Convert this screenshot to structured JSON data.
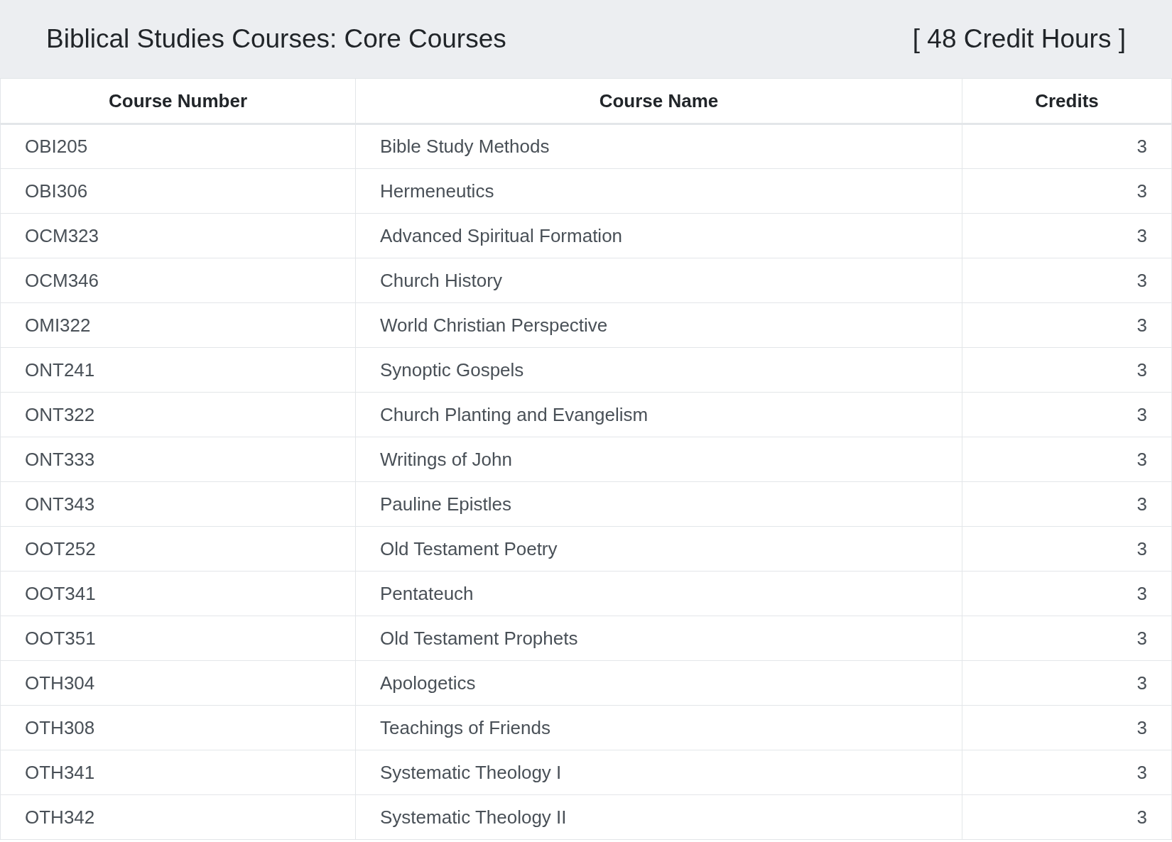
{
  "header": {
    "title": "Biblical Studies Courses: Core Courses",
    "credit_hours": "[ 48 Credit Hours ]"
  },
  "table": {
    "columns": [
      "Course Number",
      "Course Name",
      "Credits"
    ],
    "rows": [
      {
        "number": "OBI205",
        "name": "Bible Study Methods",
        "credits": "3"
      },
      {
        "number": "OBI306",
        "name": "Hermeneutics",
        "credits": "3"
      },
      {
        "number": "OCM323",
        "name": "Advanced Spiritual Formation",
        "credits": "3"
      },
      {
        "number": "OCM346",
        "name": "Church History",
        "credits": "3"
      },
      {
        "number": "OMI322",
        "name": "World Christian Perspective",
        "credits": "3"
      },
      {
        "number": "ONT241",
        "name": "Synoptic Gospels",
        "credits": "3"
      },
      {
        "number": "ONT322",
        "name": "Church Planting and Evangelism",
        "credits": "3"
      },
      {
        "number": "ONT333",
        "name": "Writings of John",
        "credits": "3"
      },
      {
        "number": "ONT343",
        "name": "Pauline Epistles",
        "credits": "3"
      },
      {
        "number": "OOT252",
        "name": "Old Testament Poetry",
        "credits": "3"
      },
      {
        "number": "OOT341",
        "name": "Pentateuch",
        "credits": "3"
      },
      {
        "number": "OOT351",
        "name": "Old Testament Prophets",
        "credits": "3"
      },
      {
        "number": "OTH304",
        "name": "Apologetics",
        "credits": "3"
      },
      {
        "number": "OTH308",
        "name": "Teachings of Friends",
        "credits": "3"
      },
      {
        "number": "OTH341",
        "name": "Systematic Theology I",
        "credits": "3"
      },
      {
        "number": "OTH342",
        "name": "Systematic Theology II",
        "credits": "3"
      }
    ]
  }
}
